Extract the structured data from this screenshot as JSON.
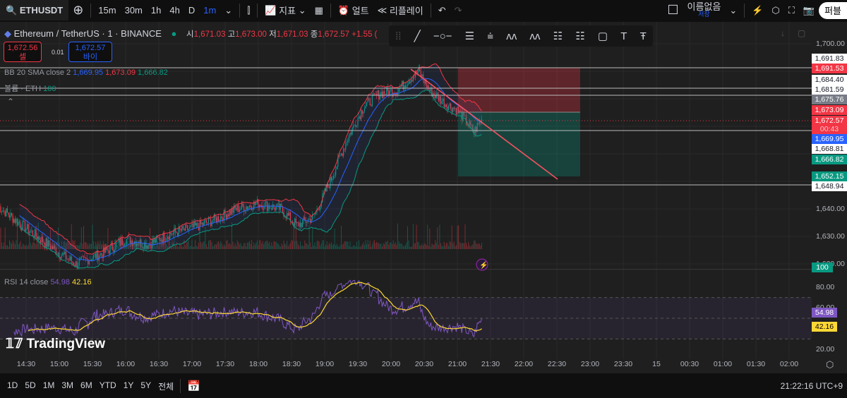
{
  "toolbar": {
    "symbol": "ETHUSDT",
    "intervals": [
      "15m",
      "30m",
      "1h",
      "4h",
      "D",
      "1m"
    ],
    "active_interval": "1m",
    "indicators": "지표",
    "alert": "얼트",
    "replay": "리플레이",
    "layout_name": "이름없음",
    "save": "저장",
    "publish": "퍼블"
  },
  "legend": {
    "title": "Ethereum / TetherUS · 1 · BINANCE",
    "o_label": "시",
    "o": "1,671.03",
    "h_label": "고",
    "h": "1,673.00",
    "l_label": "저",
    "l": "1,671.03",
    "c_label": "종",
    "c": "1,672.57",
    "change": "+1.55 (",
    "sell_price": "1,672.56",
    "sell_label": "셀",
    "spread": "0.01",
    "buy_price": "1,672.57",
    "buy_label": "바이",
    "bb": {
      "name": "BB 20 SMA close 2",
      "basis": "1,669.95",
      "upper": "1,673.09",
      "lower": "1,666.82"
    },
    "volume": {
      "name": "볼륨 · ETH",
      "value": "100"
    },
    "rsi": {
      "name": "RSI 14 close",
      "value": "54.98",
      "ma": "42.16"
    }
  },
  "price_axis": [
    "1,700.00",
    "1,640.00",
    "1,630.00",
    "1,620.00"
  ],
  "price_tags": [
    {
      "v": "1,691.83",
      "bg": "#ffffff",
      "fg": "#131722"
    },
    {
      "v": "1,691.53",
      "bg": "#f23645",
      "fg": "#ffffff"
    },
    {
      "v": "1,684.40",
      "bg": "#ffffff",
      "fg": "#131722"
    },
    {
      "v": "1,681.59",
      "bg": "#ffffff",
      "fg": "#131722"
    },
    {
      "v": "1,675.76",
      "bg": "#787b86",
      "fg": "#ffffff"
    },
    {
      "v": "1,673.09",
      "bg": "#f23645",
      "fg": "#ffffff"
    },
    {
      "v": "1,672.57",
      "bg": "#f23645",
      "fg": "#ffffff"
    },
    {
      "v": "00:43",
      "bg": "#f23645",
      "fg": "#ffc2c6"
    },
    {
      "v": "1,669.95",
      "bg": "#2962ff",
      "fg": "#ffffff"
    },
    {
      "v": "1,668.81",
      "bg": "#ffffff",
      "fg": "#131722"
    },
    {
      "v": "1,666.82",
      "bg": "#089981",
      "fg": "#ffffff"
    },
    {
      "v": "1,652.15",
      "bg": "#089981",
      "fg": "#ffffff"
    },
    {
      "v": "1,648.94",
      "bg": "#ffffff",
      "fg": "#131722"
    }
  ],
  "rsi_axis": [
    "80.00",
    "60.00",
    "20.00"
  ],
  "volume_tag": "100",
  "time_axis": [
    "14:30",
    "15:00",
    "15:30",
    "16:00",
    "16:30",
    "17:00",
    "17:30",
    "18:00",
    "18:30",
    "19:00",
    "19:30",
    "20:00",
    "20:30",
    "21:00",
    "21:30",
    "22:00",
    "22:30",
    "23:00",
    "23:30",
    "15",
    "00:30",
    "01:00",
    "01:30",
    "02:00"
  ],
  "ranges": [
    "1D",
    "5D",
    "1M",
    "3M",
    "6M",
    "YTD",
    "1Y",
    "5Y",
    "전체"
  ],
  "clock": "21:22:16 UTC+9",
  "watermark": "TradingView",
  "colors": {
    "up": "#089981",
    "down": "#f23645",
    "bb_basis": "#2962ff",
    "rsi": "#7e57c2",
    "rsi_ma": "#fdd835"
  },
  "chart_data": {
    "type": "candlestick",
    "approx_path": [
      [
        "14:05",
        1641
      ],
      [
        "14:20",
        1636
      ],
      [
        "14:40",
        1630
      ],
      [
        "15:00",
        1624
      ],
      [
        "15:15",
        1620
      ],
      [
        "15:40",
        1624
      ],
      [
        "16:00",
        1629
      ],
      [
        "16:20",
        1627
      ],
      [
        "16:40",
        1631
      ],
      [
        "17:00",
        1633
      ],
      [
        "17:20",
        1636
      ],
      [
        "17:40",
        1640
      ],
      [
        "18:00",
        1642
      ],
      [
        "18:20",
        1640
      ],
      [
        "18:35",
        1634
      ],
      [
        "18:50",
        1637
      ],
      [
        "19:05",
        1650
      ],
      [
        "19:20",
        1665
      ],
      [
        "19:35",
        1677
      ],
      [
        "19:50",
        1682
      ],
      [
        "20:05",
        1683
      ],
      [
        "20:25",
        1690
      ],
      [
        "20:35",
        1683
      ],
      [
        "20:50",
        1678
      ],
      [
        "21:00",
        1676
      ],
      [
        "21:15",
        1668
      ],
      [
        "21:22",
        1672.57
      ]
    ]
  }
}
